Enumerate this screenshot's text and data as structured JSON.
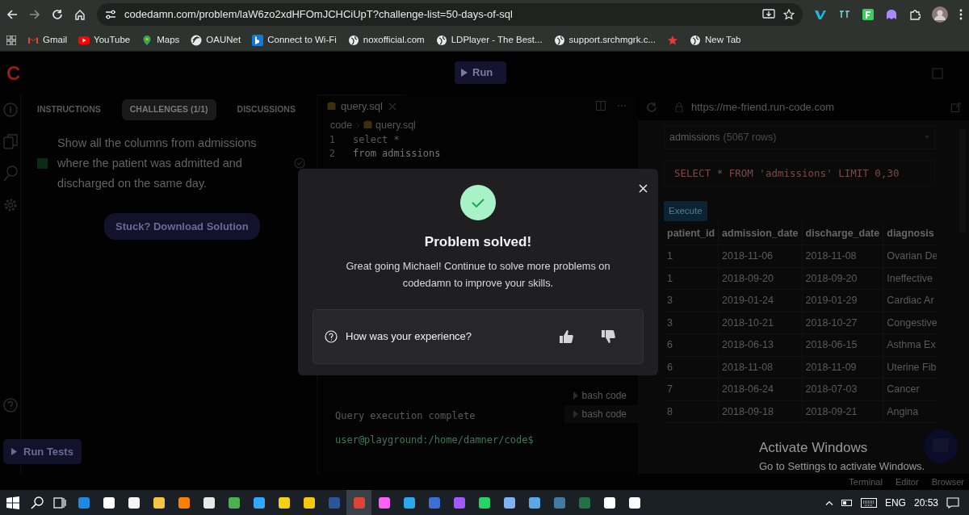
{
  "browser": {
    "url": "codedamn.com/problem/laW6zo2xdHFOmJCHCiUpT?challenge-list=50-days-of-sql",
    "bookmarks": [
      {
        "label": "Gmail",
        "kind": "gmail"
      },
      {
        "label": "YouTube",
        "kind": "youtube"
      },
      {
        "label": "Maps",
        "kind": "maps"
      },
      {
        "label": "OAUNet",
        "kind": "oau"
      },
      {
        "label": "Connect to Wi-Fi",
        "kind": "bing"
      },
      {
        "label": "noxofficial.com",
        "kind": "globe"
      },
      {
        "label": "LDPlayer - The Best...",
        "kind": "globe"
      },
      {
        "label": "support.srchmgrk.c...",
        "kind": "globe"
      },
      {
        "kind": "star"
      },
      {
        "label": "New Tab",
        "kind": "globe"
      }
    ]
  },
  "app": {
    "logo": "C",
    "run_button": "Run",
    "tabs": [
      {
        "label": "INSTRUCTIONS",
        "selected": false
      },
      {
        "label": "CHALLENGES (1/1)",
        "selected": true
      },
      {
        "label": "DISCUSSIONS",
        "selected": false
      }
    ],
    "challenge": {
      "text": "Show all the columns from admissions where the patient was admitted and discharged on the same day.",
      "completed": true
    },
    "solution_button": "Stuck? Download Solution",
    "run_tests_button": "Run Tests"
  },
  "editor": {
    "tab": "query.sql",
    "breadcrumb": [
      "code",
      "query.sql"
    ],
    "lines": [
      {
        "number": "1",
        "code": "select *"
      },
      {
        "number": "2",
        "code": "from admissions"
      }
    ],
    "terminal": [
      "Query execution complete",
      "user@playground:/home/damner/code$"
    ],
    "terminal_tabs": [
      "bash code",
      "bash code"
    ]
  },
  "preview": {
    "url": "https://me-friend.run-code.com",
    "table_select": "admissions",
    "row_count": "(5067 rows)",
    "query": "SELECT * FROM 'admissions' LIMIT 0,30",
    "execute_button": "Execute",
    "table": {
      "columns": [
        "patient_id",
        "admission_date",
        "discharge_date",
        "diagnosis"
      ],
      "rows": [
        [
          "1",
          "2018-11-06",
          "2018-11-08",
          "Ovarian De"
        ],
        [
          "1",
          "2018-09-20",
          "2018-09-20",
          "Ineffective"
        ],
        [
          "3",
          "2019-01-24",
          "2019-01-29",
          "Cardiac Ar"
        ],
        [
          "3",
          "2018-10-21",
          "2018-10-27",
          "Congestive"
        ],
        [
          "6",
          "2018-06-13",
          "2018-06-15",
          "Asthma Ex"
        ],
        [
          "6",
          "2018-11-08",
          "2018-11-09",
          "Uterine Fib"
        ],
        [
          "7",
          "2018-06-24",
          "2018-07-03",
          "Cancer"
        ],
        [
          "8",
          "2018-09-18",
          "2018-09-21",
          "Angina"
        ]
      ]
    }
  },
  "bottom_tabs": [
    "Terminal",
    "Editor",
    "Browser"
  ],
  "modal": {
    "title": "Problem solved!",
    "message": "Great going Michael! Continue to solve more problems on codedamn to improve your skills.",
    "feedback_prompt": "How was your experience?"
  },
  "os_notice": {
    "title": "Activate Windows",
    "text": "Go to Settings to activate Windows."
  },
  "taskbar": {
    "language": "ENG",
    "time": "20:53"
  }
}
